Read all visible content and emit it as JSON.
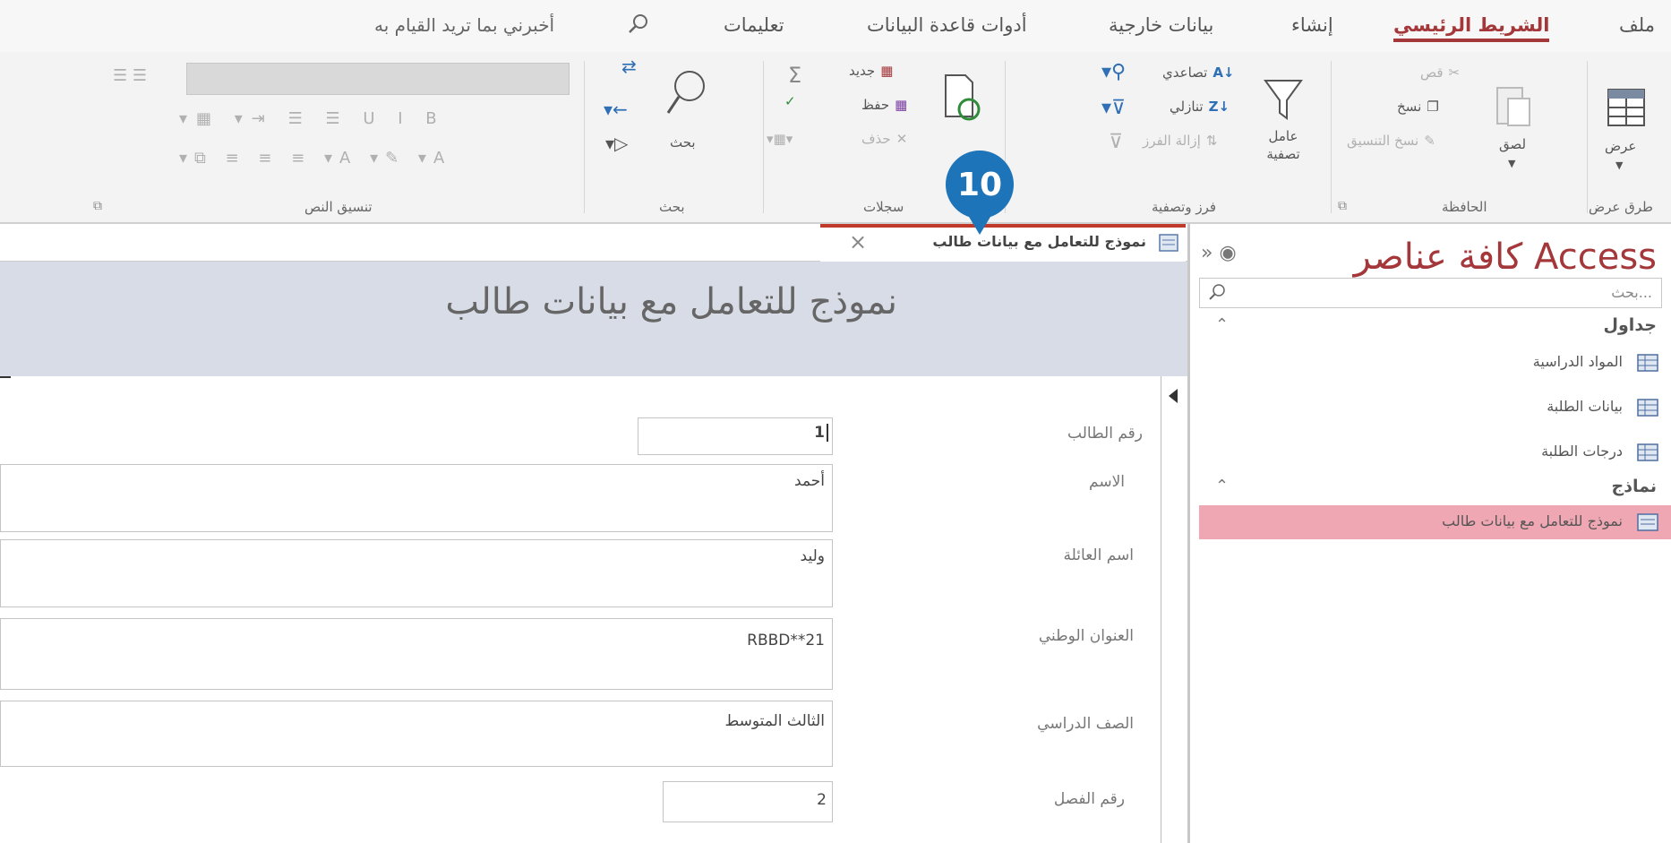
{
  "tabs": {
    "file": "ملف",
    "home": "الشريط الرئيسي",
    "create": "إنشاء",
    "external_data": "بيانات خارجية",
    "database_tools": "أدوات قاعدة البيانات",
    "help": "تعليمات",
    "tell_me": "أخبرني بما تريد القيام به"
  },
  "ribbon": {
    "views": {
      "label": "طرق عرض",
      "view_button": "عرض"
    },
    "clipboard": {
      "label": "الحافظة",
      "paste": "لصق",
      "cut": "قص",
      "copy": "نسخ",
      "format_painter": "نسخ التنسيق"
    },
    "sort_filter": {
      "label": "فرز وتصفية",
      "filter": "عامل تصفية",
      "ascending": "تصاعدي",
      "descending": "تنازلي",
      "remove_sort": "إزالة الفرز"
    },
    "records": {
      "label": "سجلات",
      "new": "جديد",
      "save": "حفظ",
      "delete": "حذف"
    },
    "find": {
      "label": "بحث",
      "find_button": "بحث"
    },
    "text_formatting": {
      "label": "تنسيق النص"
    }
  },
  "nav": {
    "title": "كافة عناصر Access",
    "search_placeholder": "بحث...",
    "groups": [
      {
        "label": "جداول",
        "items": [
          "المواد الدراسية",
          "بيانات الطلبة",
          "درجات الطلبة"
        ]
      },
      {
        "label": "نماذج",
        "items": [
          "نموذج للتعامل مع بيانات طالب"
        ]
      }
    ]
  },
  "document": {
    "tab_label": "نموذج للتعامل مع بيانات طالب",
    "callout_number": "10",
    "form_title": "نموذج للتعامل مع بيانات طالب",
    "fields": [
      {
        "label": "رقم الطالب",
        "value": "1"
      },
      {
        "label": "الاسم",
        "value": "أحمد"
      },
      {
        "label": "اسم العائلة",
        "value": "وليد"
      },
      {
        "label": "العنوان الوطني",
        "value": "RBBD**21"
      },
      {
        "label": "الصف الدراسي",
        "value": "الثالث المتوسط"
      },
      {
        "label": "رقم الفصل",
        "value": "2"
      }
    ]
  },
  "colors": {
    "accent": "#a4373a",
    "callout": "#1e74b8",
    "form_header": "#d7dce6",
    "selected_item": "#f0a7b4"
  }
}
